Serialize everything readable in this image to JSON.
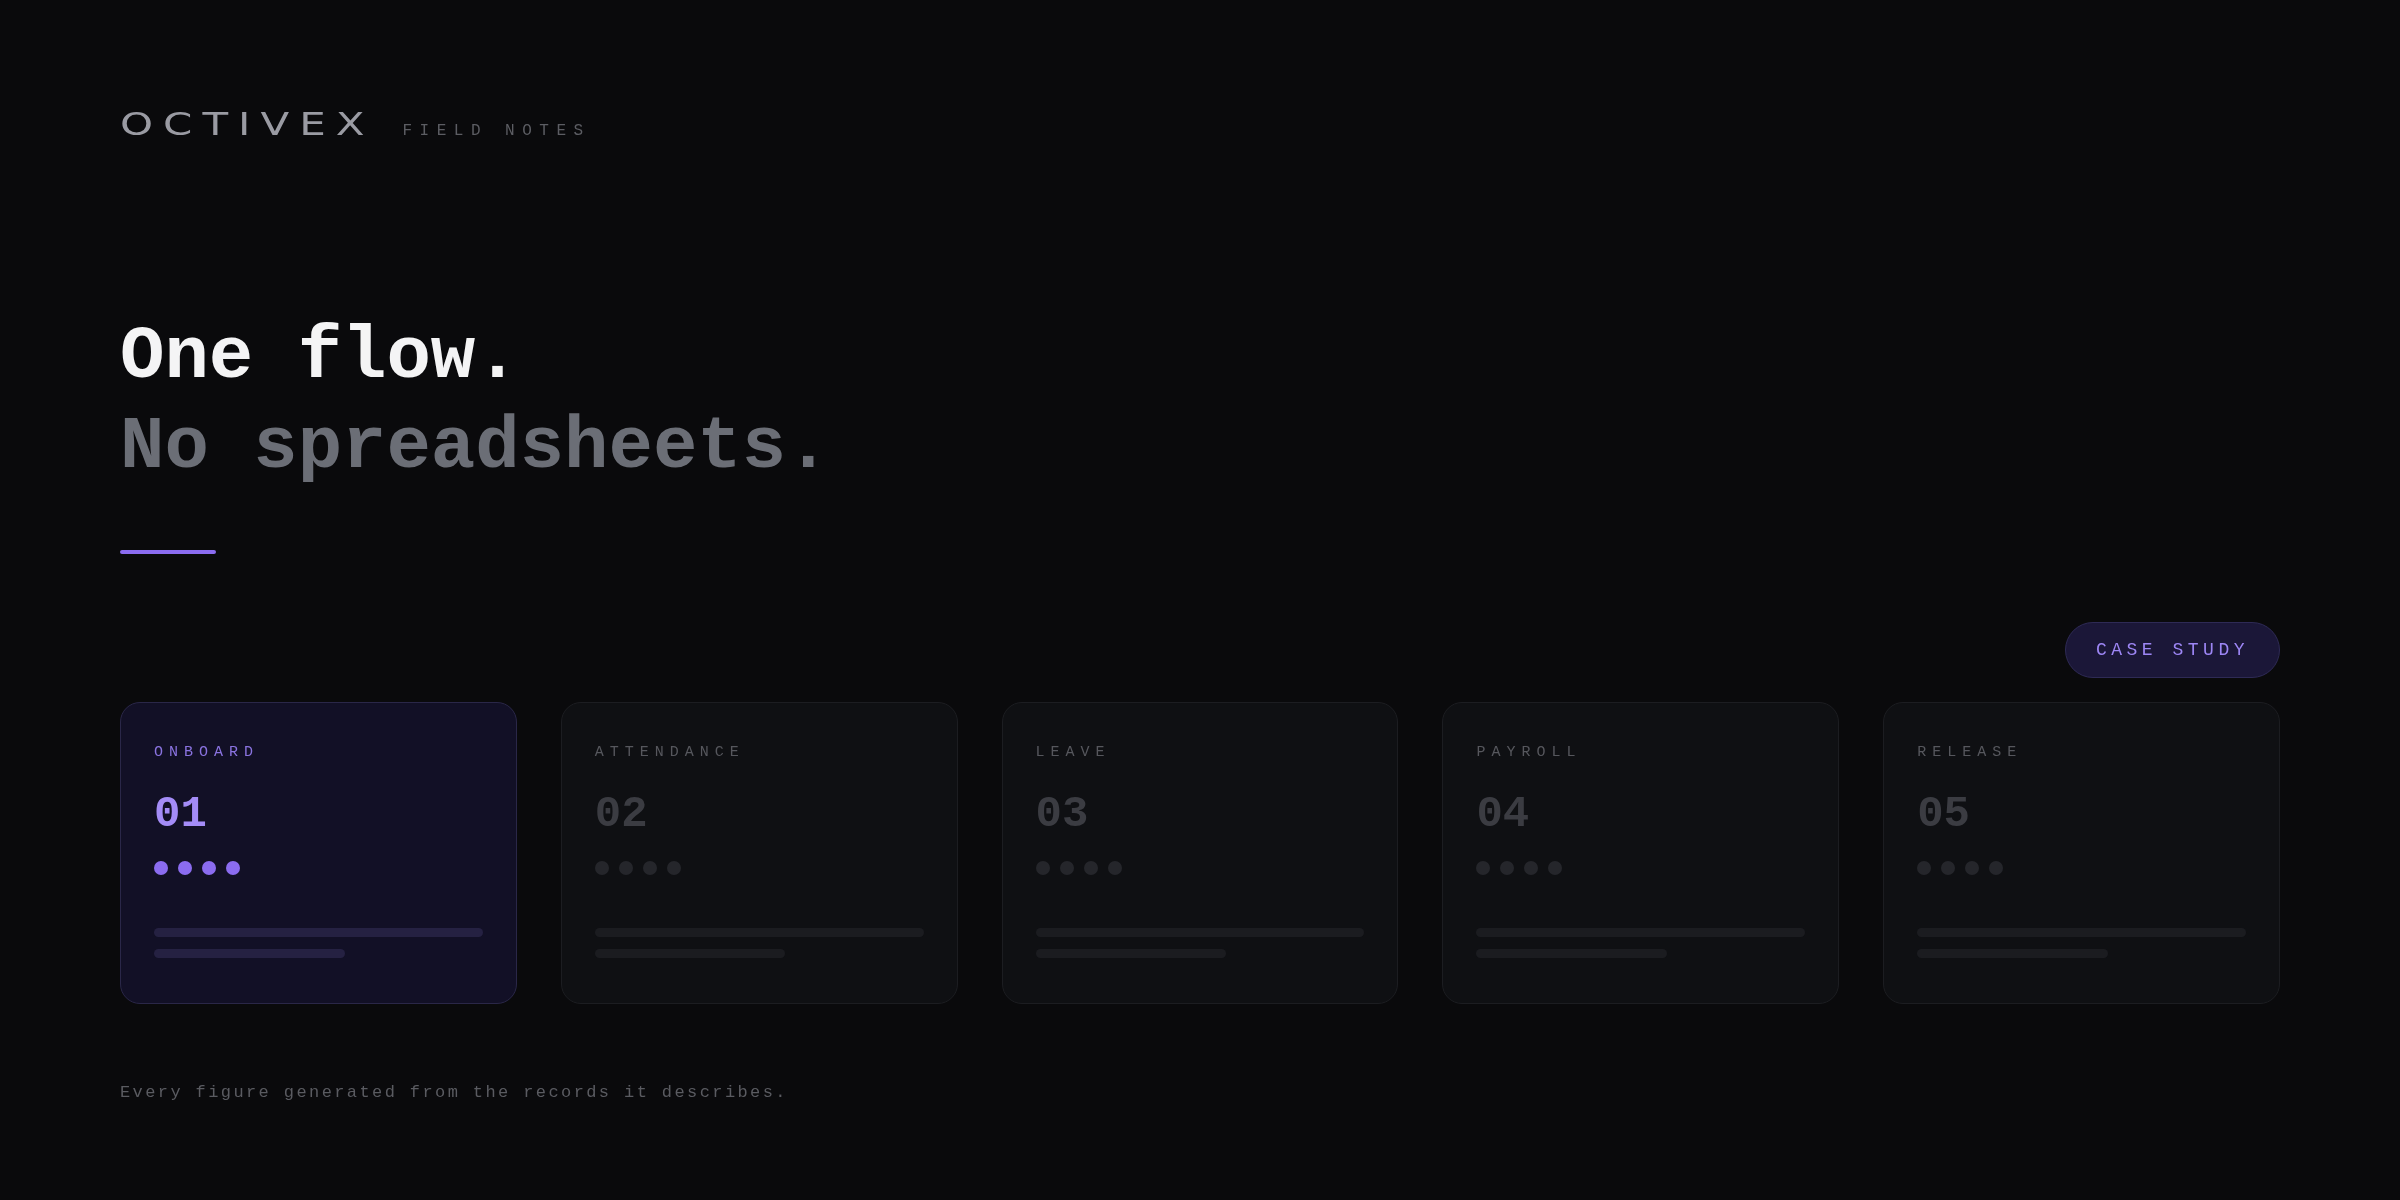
{
  "brand": {
    "logo": "OCTIVEX",
    "tagline": "FIELD NOTES"
  },
  "headline": {
    "line_1": "One flow.",
    "line_2": "No spreadsheets."
  },
  "badge": "CASE STUDY",
  "cards": [
    {
      "label": "ONBOARD",
      "number": "01",
      "selected": true
    },
    {
      "label": "ATTENDANCE",
      "number": "02",
      "selected": false
    },
    {
      "label": "LEAVE",
      "number": "03",
      "selected": false
    },
    {
      "label": "PAYROLL",
      "number": "04",
      "selected": false
    },
    {
      "label": "RELEASE",
      "number": "05",
      "selected": false
    }
  ],
  "footer": "Every figure generated from the records it describes."
}
